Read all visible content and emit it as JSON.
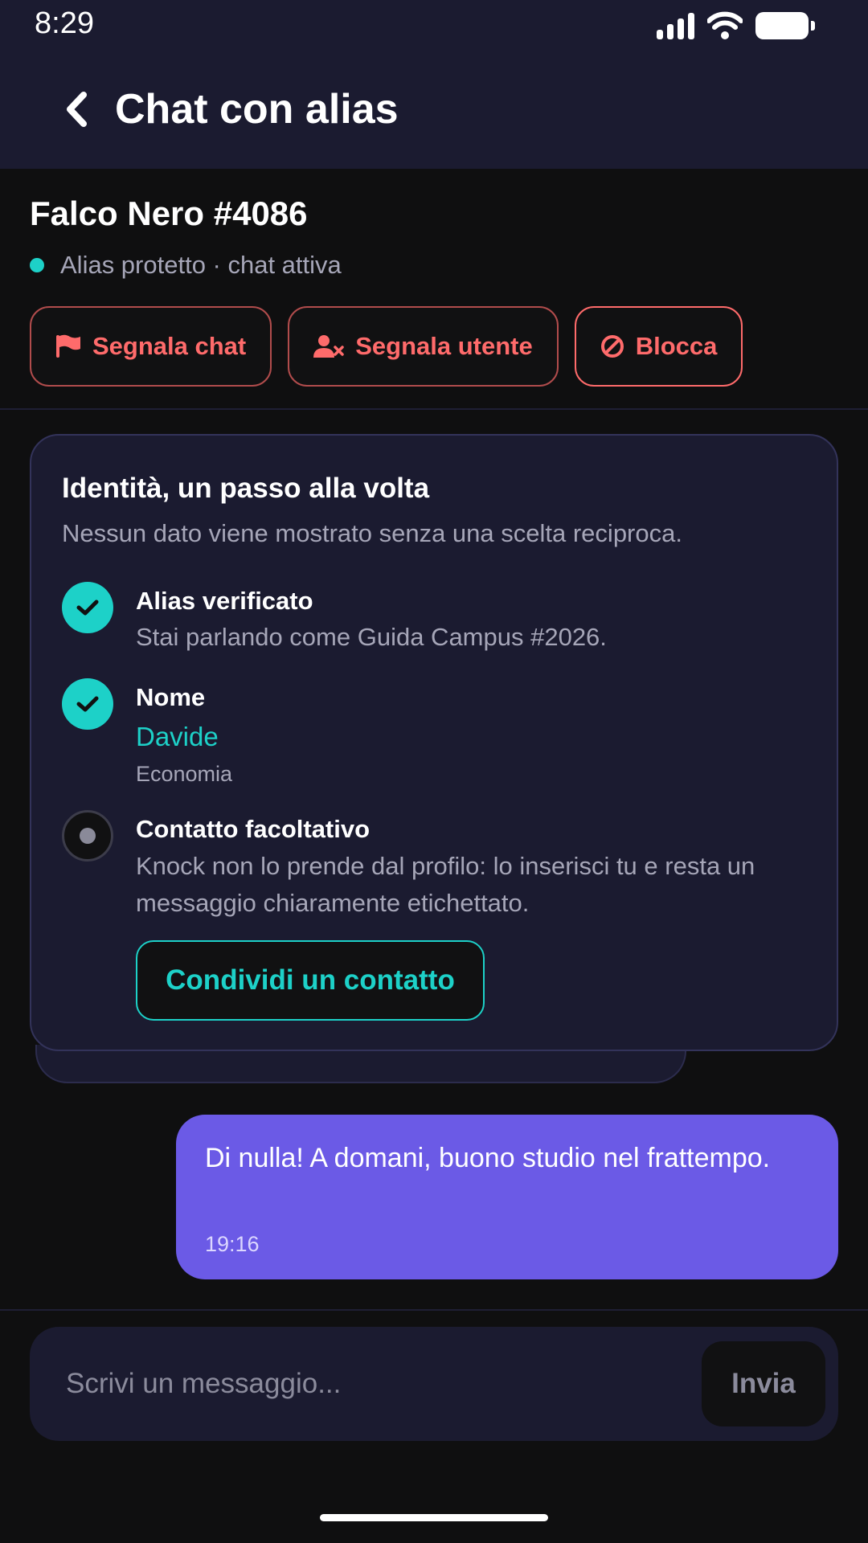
{
  "status_bar": {
    "time": "8:29"
  },
  "header": {
    "title": "Chat con alias",
    "back_icon": "chevron-left-icon"
  },
  "profile": {
    "name": "Falco Nero #4086",
    "status": "Alias protetto · chat attiva",
    "status_color": "#1dd1c8"
  },
  "actions": {
    "report_chat": "Segnala chat",
    "report_user": "Segnala utente",
    "block": "Blocca",
    "color": "#ff6b6b"
  },
  "identity": {
    "title": "Identità, un passo alla volta",
    "subtitle": "Nessun dato viene mostrato senza una scelta reciproca.",
    "steps": [
      {
        "title": "Alias verificato",
        "text": "Stai parlando come Guida Campus #2026.",
        "state": "done"
      },
      {
        "title": "Nome",
        "value": "Davide",
        "detail": "Economia",
        "state": "done"
      },
      {
        "title": "Contatto facoltativo",
        "text": "Knock non lo prende dal profilo: lo inserisci tu e resta un messaggio chiaramente etichettato.",
        "state": "pending",
        "button": "Condividi un contatto"
      }
    ]
  },
  "message": {
    "text": "Di nulla! A domani, buono studio nel frattempo.",
    "time": "19:16",
    "bubble_color": "#6b5ae6"
  },
  "composer": {
    "placeholder": "Scrivi un messaggio...",
    "send_label": "Invia"
  },
  "colors": {
    "background": "#0f0f10",
    "surface": "#1b1b30",
    "accent": "#1dd1c8"
  }
}
